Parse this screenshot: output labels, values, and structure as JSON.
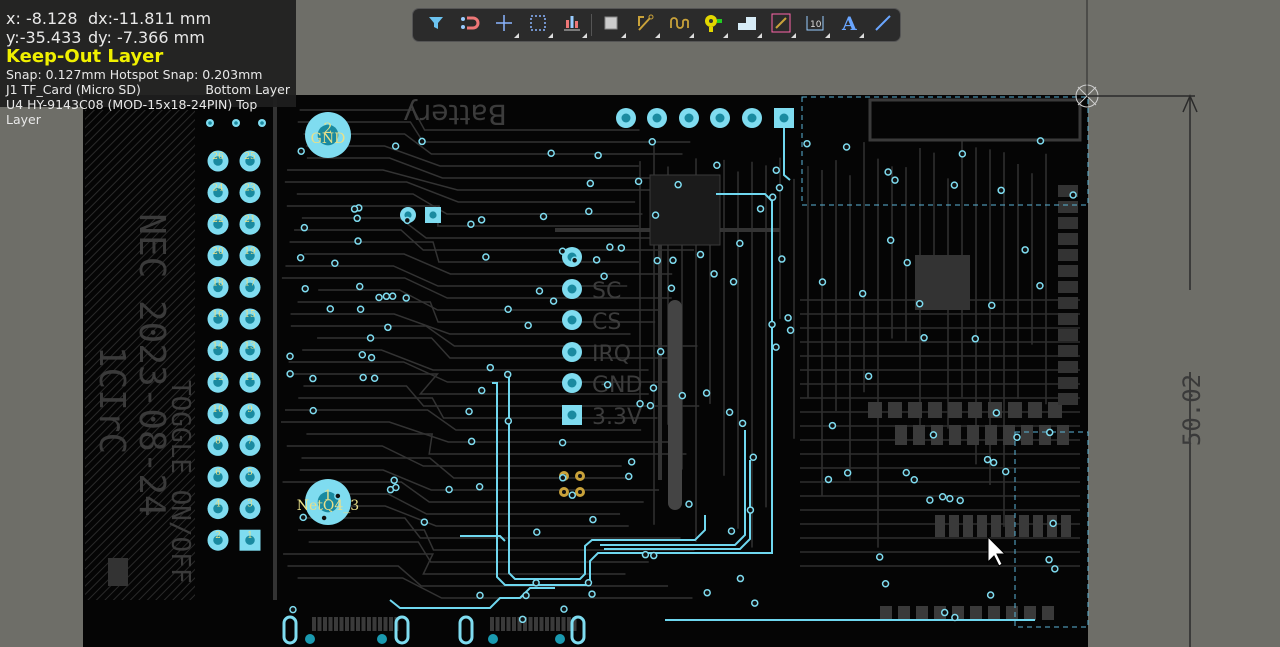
{
  "hud": {
    "x": "x: -8.128",
    "dx": "dx:-11.811 mm",
    "y": "y:-35.433",
    "dy": "dy: -7.366  mm",
    "layer": "Keep-Out Layer",
    "snap": "Snap: 0.127mm Hotspot Snap: 0.203mm",
    "comp1_name": "J1  TF_Card (Micro SD)",
    "comp1_layer": "Bottom Layer",
    "comp2": "U4 HY-9143C08 (MOD-15x18-24PIN) Top Layer"
  },
  "toolbar": [
    {
      "icon": "filter-icon",
      "sub": false
    },
    {
      "icon": "magnet-icon",
      "sub": false
    },
    {
      "icon": "crosshair-icon",
      "sub": true
    },
    {
      "icon": "select-rect-icon",
      "sub": true
    },
    {
      "icon": "align-icon",
      "sub": true
    },
    {
      "icon": "component-icon",
      "sub": true
    },
    {
      "icon": "route-icon",
      "sub": true
    },
    {
      "icon": "interactive-length-icon",
      "sub": true
    },
    {
      "icon": "via-icon",
      "sub": true
    },
    {
      "icon": "polygon-icon",
      "sub": true
    },
    {
      "icon": "place-track-icon",
      "sub": true
    },
    {
      "icon": "dimension-icon",
      "sub": true
    },
    {
      "icon": "text-icon",
      "sub": true
    },
    {
      "icon": "line-icon",
      "sub": false
    }
  ],
  "toolbar_text_glyph": "A",
  "toolbar_dim_glyph": "10",
  "board": {
    "silk_battery": "Battery",
    "silk_side1": "NEC 2023-08-24",
    "silk_side2": "1CIrC",
    "silk_bottom": "TOGGLE ON/OFF",
    "big_pad_top": {
      "num": "2",
      "net": "GND"
    },
    "big_pad_bottom": {
      "num": "1",
      "net": "NetQ4_3"
    },
    "header_pins": [
      [
        "26",
        "25"
      ],
      [
        "24",
        "23"
      ],
      [
        "22",
        "21"
      ],
      [
        "20",
        "19"
      ],
      [
        "18",
        "17"
      ],
      [
        "16",
        "15"
      ],
      [
        "14",
        "13"
      ],
      [
        "12",
        "11"
      ],
      [
        "10",
        "9"
      ],
      [
        "8",
        "7"
      ],
      [
        "6",
        "5"
      ],
      [
        "4",
        "3"
      ],
      [
        "2",
        "1"
      ]
    ],
    "side_labels": [
      "SC",
      "CS",
      "IRQ",
      "GND",
      "3.3V"
    ],
    "dimension": "50.02"
  },
  "colors": {
    "pad": "#7fdcf0",
    "trace_hl": "#6fd7ef",
    "track": "#3a3a3a",
    "board": "#050505",
    "bg": "#6e6e68",
    "layer": "#f0f000"
  }
}
